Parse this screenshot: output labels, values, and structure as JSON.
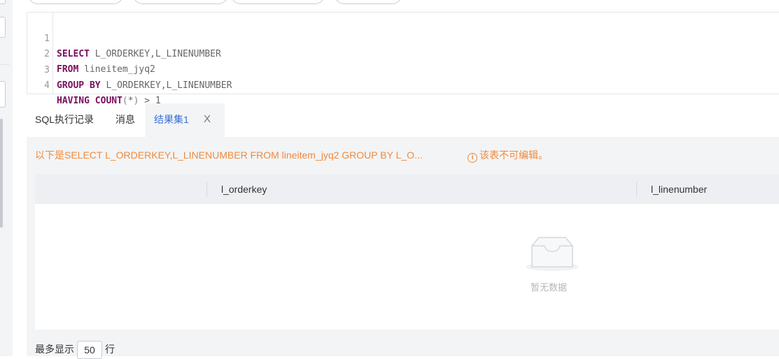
{
  "editor": {
    "lines": [
      {
        "num": "1",
        "kw": "SELECT",
        "rest": " L_ORDERKEY,L_LINENUMBER"
      },
      {
        "num": "2",
        "kw": "FROM",
        "rest": " lineitem_jyq2"
      },
      {
        "num": "3",
        "kw": "GROUP BY",
        "rest": " L_ORDERKEY,L_LINENUMBER"
      },
      {
        "num": "4",
        "kw": "HAVING COUNT",
        "paren_open": "(",
        "star": "*",
        "paren_close": ")",
        "tail": " > 1"
      }
    ]
  },
  "tabs": {
    "history": "SQL执行记录",
    "messages": "消息",
    "result": "结果集1",
    "close": "X"
  },
  "result": {
    "notice": "以下是SELECT L_ORDERKEY,L_LINENUMBER FROM lineitem_jyq2 GROUP BY L_O...",
    "info_icon": "i",
    "readonly": "该表不可编辑。",
    "columns": [
      "l_orderkey",
      "l_linenumber"
    ],
    "empty_text": "暂无数据"
  },
  "footer": {
    "prefix": "最多显示",
    "limit": "50",
    "suffix": "行"
  }
}
